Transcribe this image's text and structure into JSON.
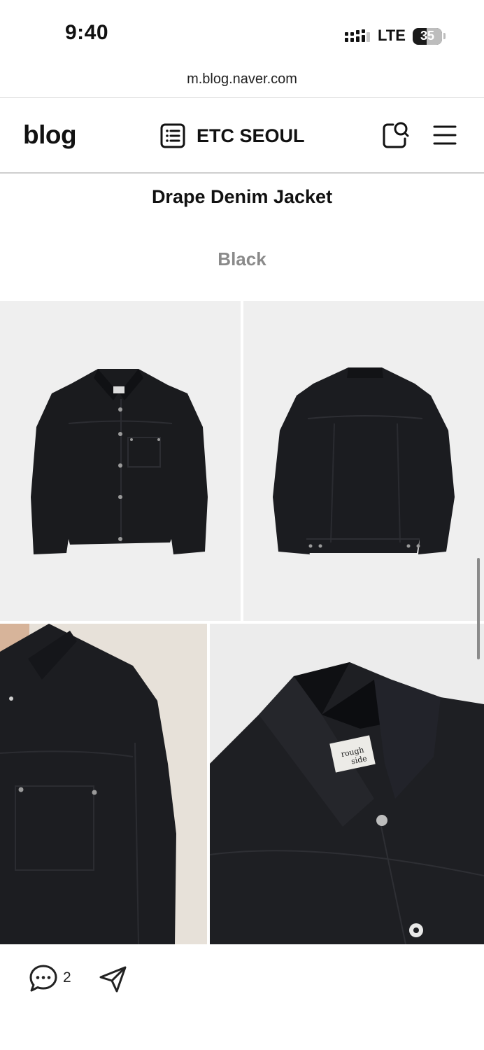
{
  "status_bar": {
    "time": "9:40",
    "network": "LTE",
    "battery": "35"
  },
  "browser": {
    "url": "m.blog.naver.com"
  },
  "header": {
    "logo": "blog",
    "blog_name": "ETC SEOUL",
    "icons": [
      "list-icon",
      "search-card-icon",
      "hamburger-menu-icon"
    ]
  },
  "post": {
    "title": "Drape Denim Jacket",
    "color_label": "Black",
    "images": [
      "jacket-front-photo",
      "jacket-back-photo",
      "jacket-worn-detail-photo",
      "jacket-collar-detail-photo"
    ],
    "collar_tag_text": "rough side"
  },
  "footer": {
    "comment_count": "2",
    "icons": [
      "comment-icon",
      "share-icon"
    ]
  }
}
